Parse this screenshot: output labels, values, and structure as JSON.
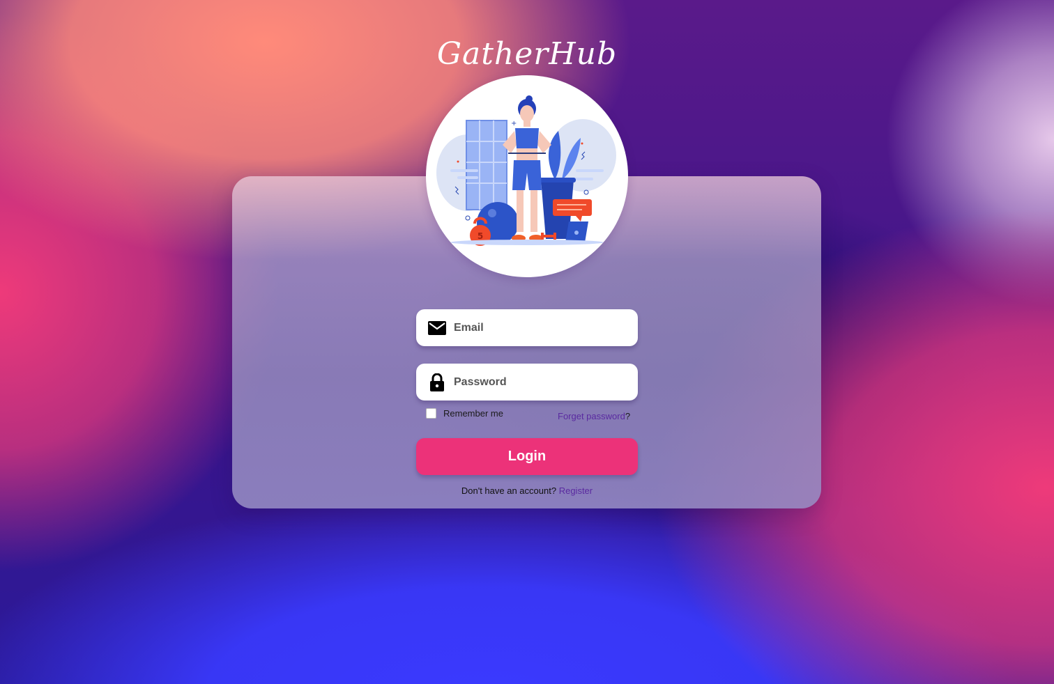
{
  "app": {
    "logo_text": "GatherHub"
  },
  "login_form": {
    "email_placeholder": "Email",
    "password_placeholder": "Password",
    "remember_label": "Remember me",
    "remember_checked": false,
    "forgot_link": "Forget password",
    "forgot_suffix": "?",
    "login_button": "Login",
    "no_account_text": "Don't have an account?",
    "register_link": "Register"
  },
  "icons": {
    "email": "envelope-icon",
    "password": "lock-icon"
  },
  "illustration": {
    "kettlebell_label": "5"
  },
  "colors": {
    "accent": "#ec3279",
    "link": "#5a2aa0",
    "field_bg": "#ffffff"
  }
}
